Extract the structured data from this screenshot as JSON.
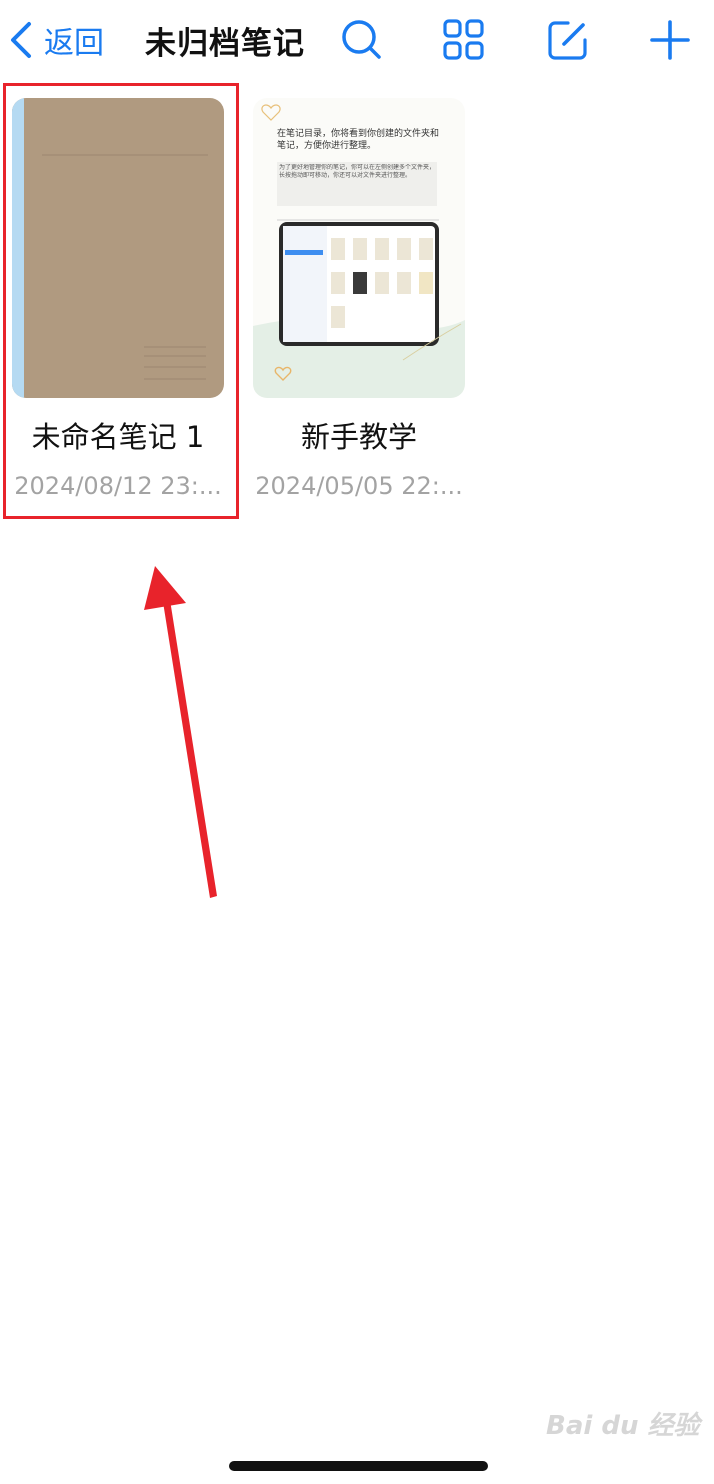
{
  "navbar": {
    "back_label": "返回",
    "title": "未归档笔记",
    "icons": [
      "search-icon",
      "grid-view-icon",
      "edit-icon",
      "add-icon"
    ],
    "accent_color": "#1a7bf0"
  },
  "notes": [
    {
      "title": "未命名笔记 1",
      "date": "2024/08/12 23:...",
      "cover": "plain-brown-notebook",
      "cover_color": "#b09a80",
      "spine_color": "#b5daf2",
      "highlighted": true
    },
    {
      "title": "新手教学",
      "date": "2024/05/05 22:...",
      "cover": "tutorial-preview",
      "preview_text_1": "在笔记目录，你将看到你创建的文件夹和笔记，方便你进行整理。",
      "preview_text_2": "为了更好地管理你的笔记，你可以在左侧创建多个文件夹，长按拖动即可移动，你还可以对文件夹进行整理。"
    }
  ],
  "annotation": {
    "highlight_color": "#e8232b"
  },
  "watermark": "Bai du 经验"
}
